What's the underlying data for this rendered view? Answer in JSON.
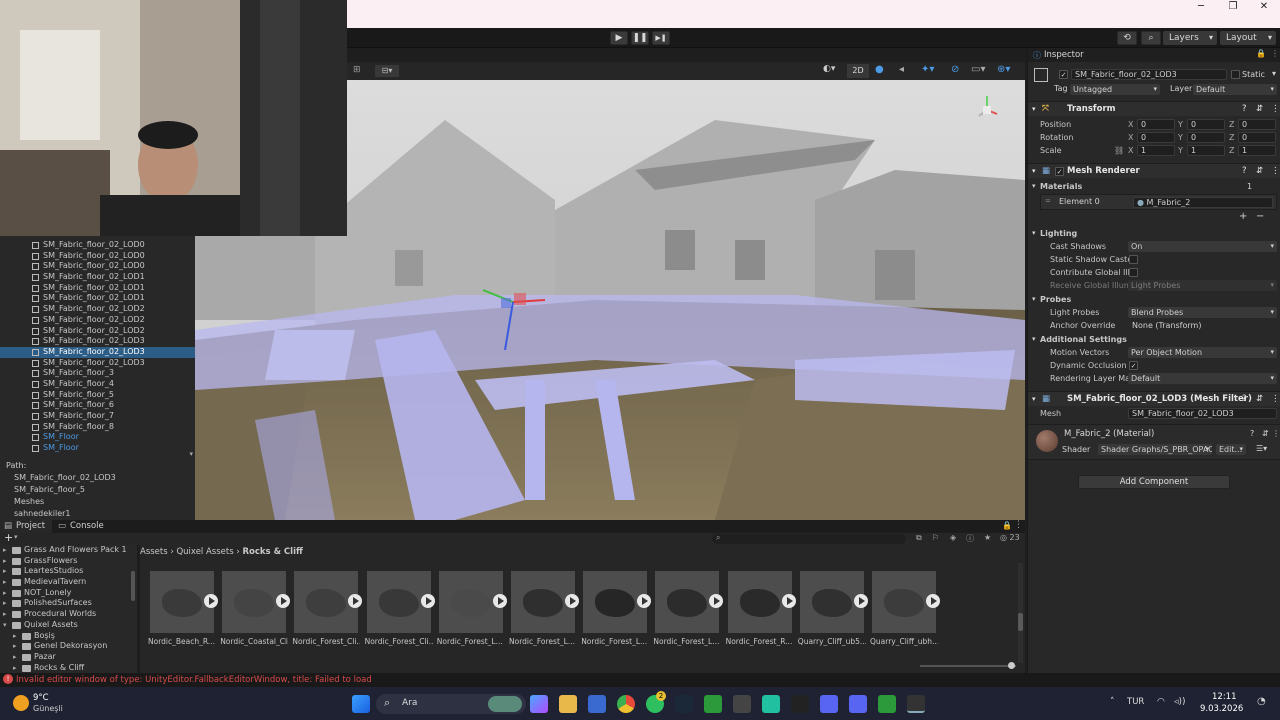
{
  "window": {
    "minimize": "─",
    "maximize": "❐",
    "close": "✕"
  },
  "toolbar": {
    "play": "▶",
    "pause": "❚❚",
    "step": "▶❚",
    "layers_label": "Layers",
    "layout_label": "Layout"
  },
  "hierarchy": {
    "items": [
      {
        "label": "SM_Fabric_floor_02_LOD0",
        "state": "normal"
      },
      {
        "label": "SM_Fabric_floor_02_LOD0",
        "state": "normal"
      },
      {
        "label": "SM_Fabric_floor_02_LOD0",
        "state": "normal"
      },
      {
        "label": "SM_Fabric_floor_02_LOD1",
        "state": "normal"
      },
      {
        "label": "SM_Fabric_floor_02_LOD1",
        "state": "normal"
      },
      {
        "label": "SM_Fabric_floor_02_LOD1",
        "state": "normal"
      },
      {
        "label": "SM_Fabric_floor_02_LOD2",
        "state": "normal"
      },
      {
        "label": "SM_Fabric_floor_02_LOD2",
        "state": "normal"
      },
      {
        "label": "SM_Fabric_floor_02_LOD2",
        "state": "normal"
      },
      {
        "label": "SM_Fabric_floor_02_LOD3",
        "state": "normal"
      },
      {
        "label": "SM_Fabric_floor_02_LOD3",
        "state": "selected"
      },
      {
        "label": "SM_Fabric_floor_02_LOD3",
        "state": "normal"
      },
      {
        "label": "SM_Fabric_floor_3",
        "state": "normal"
      },
      {
        "label": "SM_Fabric_floor_4",
        "state": "normal"
      },
      {
        "label": "SM_Fabric_floor_5",
        "state": "normal"
      },
      {
        "label": "SM_Fabric_floor_6",
        "state": "normal"
      },
      {
        "label": "SM_Fabric_floor_7",
        "state": "normal"
      },
      {
        "label": "SM_Fabric_floor_8",
        "state": "normal"
      },
      {
        "label": "SM_Floor",
        "state": "blue"
      },
      {
        "label": "SM_Floor",
        "state": "blue"
      }
    ],
    "path_label": "Path:",
    "path_items": [
      "SM_Fabric_floor_02_LOD3",
      "SM_Fabric_floor_5",
      "Meshes",
      "sahnedekiler1"
    ]
  },
  "scene_toolbar": {
    "mode_2d": "2D"
  },
  "inspector": {
    "tab_label": "Inspector",
    "object_name": "SM_Fabric_floor_02_LOD3",
    "static_label": "Static",
    "tag_label": "Tag",
    "tag_value": "Untagged",
    "layer_label": "Layer",
    "layer_value": "Default",
    "transform": {
      "title": "Transform",
      "rows": [
        {
          "label": "Position",
          "x": "0",
          "y": "0",
          "z": "0"
        },
        {
          "label": "Rotation",
          "x": "0",
          "y": "0",
          "z": "0"
        },
        {
          "label": "Scale",
          "x": "1",
          "y": "1",
          "z": "1"
        }
      ],
      "axis_x": "X",
      "axis_y": "Y",
      "axis_z": "Z"
    },
    "mesh_renderer": {
      "title": "Mesh Renderer",
      "materials_label": "Materials",
      "materials_count": "1",
      "element_label": "Element 0",
      "element_value": "M_Fabric_2",
      "plus": "+",
      "minus": "−",
      "lighting_label": "Lighting",
      "cast_shadows_label": "Cast Shadows",
      "cast_shadows_value": "On",
      "static_shadow_label": "Static Shadow Caste",
      "contribute_gi_label": "Contribute Global Illu",
      "receive_gi_label": "Receive Global Illum",
      "receive_gi_value": "Light Probes",
      "probes_label": "Probes",
      "light_probes_label": "Light Probes",
      "light_probes_value": "Blend Probes",
      "anchor_label": "Anchor Override",
      "anchor_value": "None (Transform)",
      "additional_label": "Additional Settings",
      "motion_label": "Motion Vectors",
      "motion_value": "Per Object Motion",
      "dynamic_occlusion_label": "Dynamic Occlusion",
      "rendering_layer_label": "Rendering Layer Ma",
      "rendering_layer_value": "Default"
    },
    "mesh_filter": {
      "title": "SM_Fabric_floor_02_LOD3 (Mesh Filter)",
      "mesh_label": "Mesh",
      "mesh_value": "SM_Fabric_floor_02_LOD3"
    },
    "material": {
      "title": "M_Fabric_2 (Material)",
      "shader_label": "Shader",
      "shader_value": "Shader Graphs/S_PBR_OPAC",
      "edit_label": "Edit..."
    },
    "add_component": "Add Component"
  },
  "project": {
    "tab_project": "Project",
    "tab_console": "Console",
    "add_button": "+",
    "hidden_count": "23",
    "folders": [
      {
        "label": "Grass And Flowers Pack 1",
        "indent": 0
      },
      {
        "label": "GrassFlowers",
        "indent": 0
      },
      {
        "label": "LeartesStudios",
        "indent": 0
      },
      {
        "label": "MedievalTavern",
        "indent": 0
      },
      {
        "label": "NOT_Lonely",
        "indent": 0
      },
      {
        "label": "PolishedSurfaces",
        "indent": 0
      },
      {
        "label": "Procedural Worlds",
        "indent": 0
      },
      {
        "label": "Quixel Assets",
        "indent": 0
      },
      {
        "label": "Boşiş",
        "indent": 1
      },
      {
        "label": "Genel Dekorasyon",
        "indent": 1
      },
      {
        "label": "Pazar",
        "indent": 1
      },
      {
        "label": "Rocks & Cliff",
        "indent": 1
      }
    ],
    "breadcrumb": {
      "assets": "Assets",
      "sep1": "›",
      "quixel": "Quixel Assets",
      "sep2": "›",
      "current": "Rocks & Cliff"
    },
    "assets": [
      "Nordic_Beach_R...",
      "Nordic_Coastal_Cli...",
      "Nordic_Forest_Cli...",
      "Nordic_Forest_Cli...",
      "Nordic_Forest_L...",
      "Nordic_Forest_L...",
      "Nordic_Forest_L...",
      "Nordic_Forest_L...",
      "Nordic_Forest_R...",
      "Quarry_Cliff_ub5...",
      "Quarry_Cliff_ubh..."
    ]
  },
  "status": {
    "message": "Invalid editor window of type: UnityEditor.FallbackEditorWindow, title: Failed to load"
  },
  "taskbar": {
    "weather_temp": "9°C",
    "weather_desc": "Güneşli",
    "search": "Ara",
    "lang": "TUR",
    "time": "12:11",
    "date": "9.03.2026",
    "notif_badge": "2"
  },
  "colors": {
    "selection": "#2c5d87",
    "error": "#d84a4a",
    "accent_blue": "#4d9be6"
  }
}
